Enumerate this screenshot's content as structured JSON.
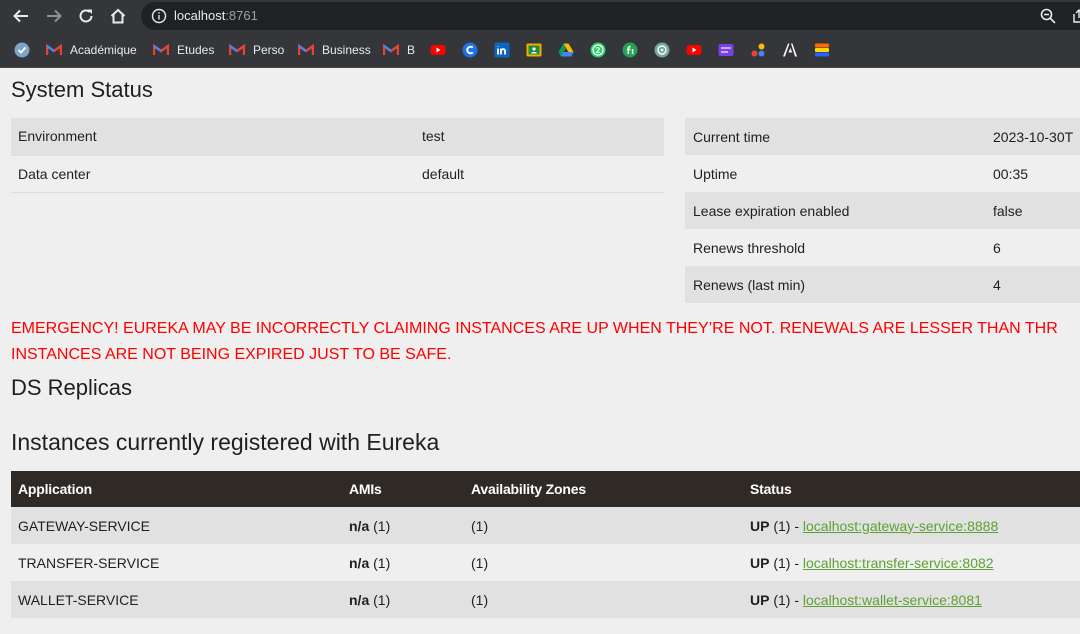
{
  "browser": {
    "url_host": "localhost",
    "url_port": ":8761",
    "bookmarks": [
      {
        "label": "Académique",
        "icon": "gmail-icon"
      },
      {
        "label": "Etudes",
        "icon": "gmail-icon"
      },
      {
        "label": "Perso",
        "icon": "gmail-icon"
      },
      {
        "label": "Business",
        "icon": "gmail-icon"
      },
      {
        "label": "B",
        "icon": "gmail-icon"
      }
    ],
    "colors": {
      "chrome_bg": "#35363a",
      "omnibox_bg": "#202124"
    }
  },
  "system_status": {
    "title": "System Status",
    "left": [
      {
        "label": "Environment",
        "value": "test"
      },
      {
        "label": "Data center",
        "value": "default"
      }
    ],
    "right": [
      {
        "label": "Current time",
        "value": "2023-10-30T"
      },
      {
        "label": "Uptime",
        "value": "00:35"
      },
      {
        "label": "Lease expiration enabled",
        "value": "false"
      },
      {
        "label": "Renews threshold",
        "value": "6"
      },
      {
        "label": "Renews (last min)",
        "value": "4"
      }
    ]
  },
  "emergency": {
    "line1": "EMERGENCY! EUREKA MAY BE INCORRECTLY CLAIMING INSTANCES ARE UP WHEN THEY’RE NOT. RENEWALS ARE LESSER THAN THR",
    "line2": "INSTANCES ARE NOT BEING EXPIRED JUST TO BE SAFE.",
    "color": "#ff0000"
  },
  "ds_replicas": {
    "title": "DS Replicas"
  },
  "instances": {
    "title": "Instances currently registered with Eureka",
    "headers": [
      "Application",
      "AMIs",
      "Availability Zones",
      "Status"
    ],
    "rows": [
      {
        "app": "GATEWAY-SERVICE",
        "ami": "n/a",
        "ami_count": "(1)",
        "zones": "(1)",
        "status": "UP",
        "status_count": "(1) -",
        "link": "localhost:gateway-service:8888"
      },
      {
        "app": "TRANSFER-SERVICE",
        "ami": "n/a",
        "ami_count": "(1)",
        "zones": "(1)",
        "status": "UP",
        "status_count": "(1) -",
        "link": "localhost:transfer-service:8082"
      },
      {
        "app": "WALLET-SERVICE",
        "ami": "n/a",
        "ami_count": "(1)",
        "zones": "(1)",
        "status": "UP",
        "status_count": "(1) -",
        "link": "localhost:wallet-service:8081"
      }
    ],
    "colors": {
      "header_bg": "#2f2a26",
      "link": "#5fa134"
    }
  }
}
